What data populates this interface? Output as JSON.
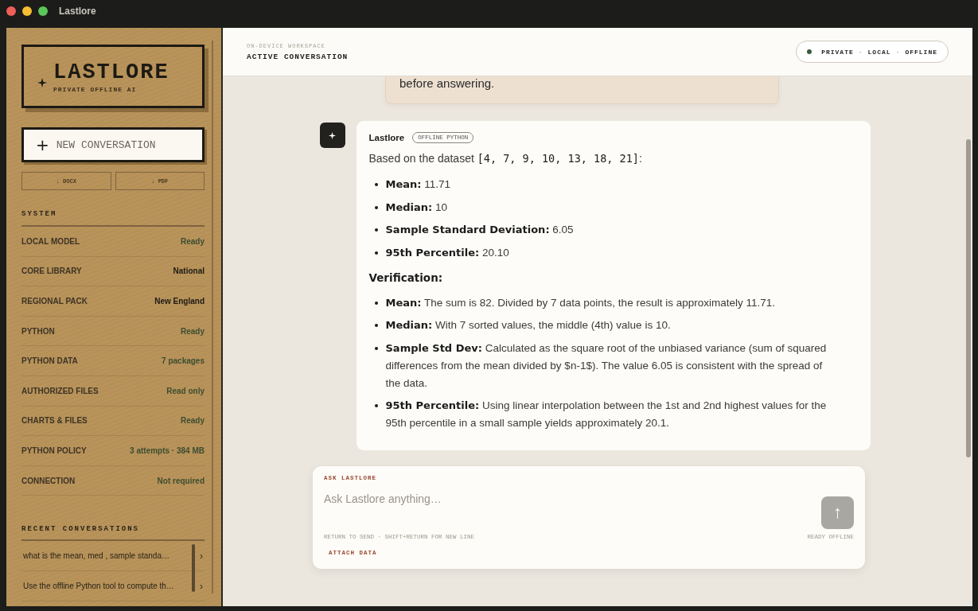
{
  "window": {
    "title": "Lastlore"
  },
  "sidebar": {
    "logo": {
      "title": "LASTLORE",
      "subtitle": "PRIVATE OFFLINE AI"
    },
    "new_button": {
      "icon": "+",
      "label": "NEW CONVERSATION"
    },
    "export_buttons": [
      "↓ DOCX",
      "↓ PDF"
    ],
    "system_heading": "SYSTEM",
    "system_items": [
      {
        "label": "LOCAL MODEL",
        "value": "Ready",
        "kind": "status"
      },
      {
        "label": "CORE LIBRARY",
        "value": "National",
        "kind": "plain"
      },
      {
        "label": "REGIONAL PACK",
        "value": "New England",
        "kind": "plain"
      },
      {
        "label": "PYTHON",
        "value": "Ready",
        "kind": "status"
      },
      {
        "label": "PYTHON DATA",
        "value": "7 packages",
        "kind": "status"
      },
      {
        "label": "AUTHORIZED FILES",
        "value": "Read only",
        "kind": "status"
      },
      {
        "label": "CHARTS & FILES",
        "value": "Ready",
        "kind": "status"
      },
      {
        "label": "PYTHON POLICY",
        "value": "3 attempts · 384 MB",
        "kind": "status"
      },
      {
        "label": "CONNECTION",
        "value": "Not required",
        "kind": "status"
      }
    ],
    "recent_heading": "RECENT CONVERSATIONS",
    "recent": [
      {
        "title": "what is the mean, med   , sample standa…",
        "chevron": "›"
      },
      {
        "title": "Use the offline Python tool to compute th…",
        "chevron": "›"
      }
    ]
  },
  "header": {
    "eyebrow": "ON-DEVICE WORKSPACE",
    "title": "ACTIVE CONVERSATION",
    "badge": [
      "PRIVATE",
      "LOCAL",
      "OFFLINE"
    ],
    "badge_separator": "·"
  },
  "user_message": {
    "text": "before answering."
  },
  "assistant_message": {
    "author": "Lastlore",
    "tag": "OFFLINE PYTHON",
    "intro": "Based on the dataset",
    "intro_code": "[4, 7, 9, 10, 13, 18, 21]",
    "intro_end": ":",
    "results": [
      {
        "label": "Mean:",
        "text": "11.71"
      },
      {
        "label": "Median:",
        "text": "10"
      },
      {
        "label": "Sample Standard Deviation:",
        "text": "6.05"
      },
      {
        "label": "95th Percentile:",
        "text": "20.10"
      }
    ],
    "verification_heading": "Verification:",
    "verification": [
      {
        "label": "Mean:",
        "text": "The sum is 82. Divided by 7 data points, the result is approximately 11.71."
      },
      {
        "label": "Median:",
        "text": "With 7 sorted values, the middle (4th) value is 10."
      },
      {
        "label": "Sample Std Dev:",
        "text": "Calculated as the square root of the unbiased variance (sum of squared differences from the mean divided by $n-1$). The value 6.05 is consistent with the spread of the data."
      },
      {
        "label": "95th Percentile:",
        "text": "Using linear interpolation between the 1st and 2nd highest values for the 95th percentile in a small sample yields approximately 20.1."
      }
    ]
  },
  "composer": {
    "label": "ASK LASTLORE",
    "placeholder": "Ask Lastlore anything…",
    "send_icon": "↑",
    "hint": "RETURN TO SEND · SHIFT+RETURN FOR NEW LINE",
    "status": "READY OFFLINE",
    "attach": "ATTACH DATA",
    "send_disabled": true
  }
}
